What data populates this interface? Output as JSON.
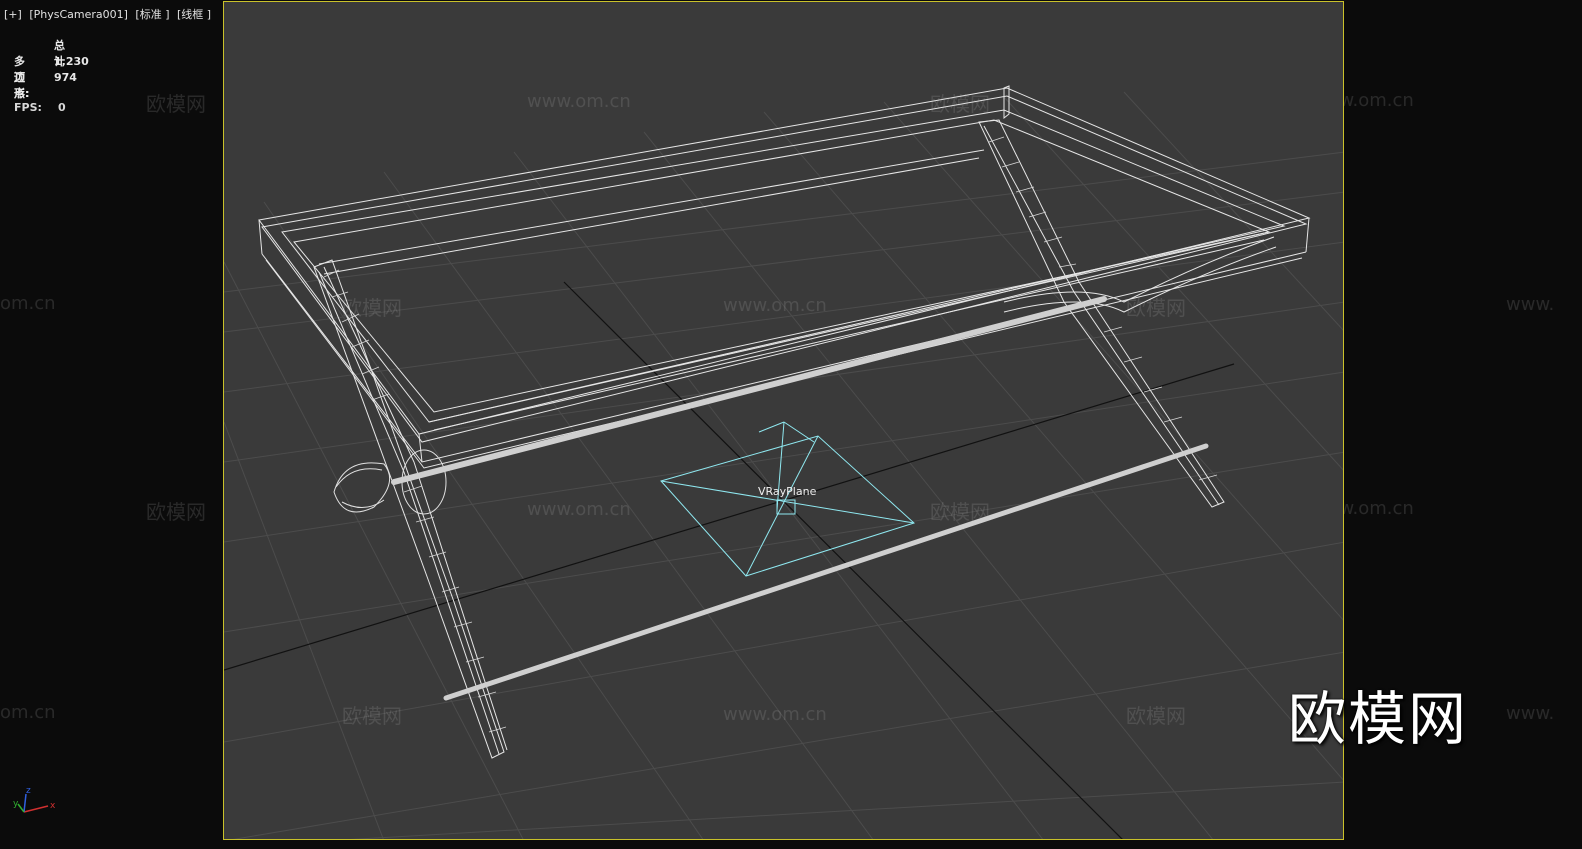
{
  "viewport": {
    "labels": [
      "[+]",
      "[PhysCamera001]",
      "[标准 ]",
      "[线框 ]"
    ]
  },
  "stats": {
    "header": "总计",
    "polygons_label": "多边形:",
    "polygons_value": "1,230",
    "vertices_label": "顶点:",
    "vertices_value": "974",
    "fps_label": "FPS:",
    "fps_value": "0"
  },
  "scene": {
    "object_label": "VRayPlane"
  },
  "watermarks": {
    "logo": "欧模网",
    "url": "www.om.cn",
    "url_partial": "www.",
    "url_tail": "om.cn"
  },
  "brand_logo": "欧模网",
  "axis": {
    "x": "x",
    "y": "y",
    "z": "z"
  },
  "colors": {
    "viewport_border": "#c9c12a",
    "viewport_bg": "#3a3a3a",
    "wireframe": "#e8e8e8",
    "vray_plane": "#8fe8f0",
    "grid": "#4e4e4e"
  }
}
